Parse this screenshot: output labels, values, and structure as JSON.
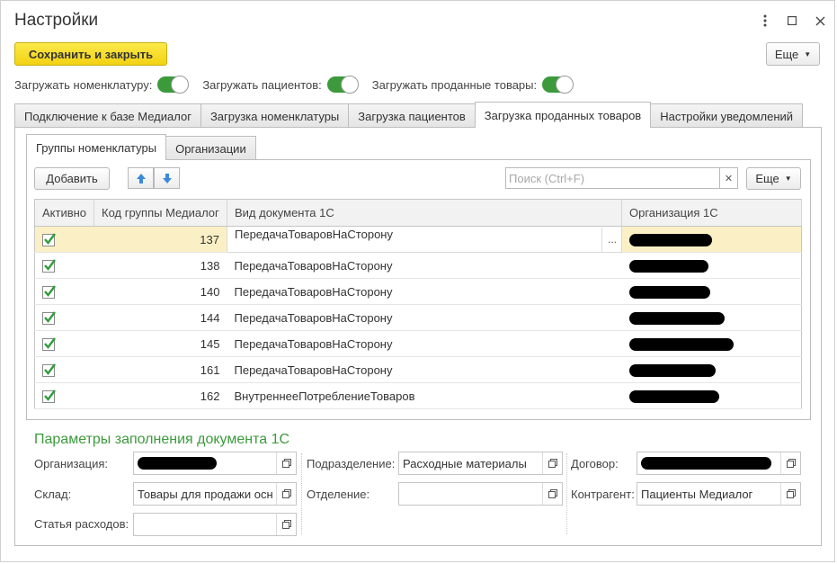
{
  "window": {
    "title": "Настройки",
    "more_label": "Еще"
  },
  "toolbar": {
    "save_close_label": "Сохранить и закрыть"
  },
  "toggles": [
    {
      "label": "Загружать номенклатуру:",
      "on": true
    },
    {
      "label": "Загружать пациентов:",
      "on": true
    },
    {
      "label": "Загружать проданные товары:",
      "on": true
    }
  ],
  "main_tabs": [
    {
      "label": "Подключение к базе Медиалог",
      "active": false
    },
    {
      "label": "Загрузка номенклатуры",
      "active": false
    },
    {
      "label": "Загрузка пациентов",
      "active": false
    },
    {
      "label": "Загрузка проданных товаров",
      "active": true
    },
    {
      "label": "Настройки уведомлений",
      "active": false
    }
  ],
  "sub_tabs": [
    {
      "label": "Группы номенклатуры",
      "active": true
    },
    {
      "label": "Организации",
      "active": false
    }
  ],
  "list_toolbar": {
    "add_label": "Добавить",
    "search_placeholder": "Поиск (Ctrl+F)",
    "more_label": "Еще"
  },
  "table": {
    "columns": [
      "Активно",
      "Код группы Медиалог",
      "Вид документа 1С",
      "Организация 1С"
    ],
    "rows": [
      {
        "active": true,
        "code": "137",
        "doc": "ПередачаТоваровНаСторону",
        "org": "[redacted]",
        "selected": true
      },
      {
        "active": true,
        "code": "138",
        "doc": "ПередачаТоваровНаСторону",
        "org": "[redacted]"
      },
      {
        "active": true,
        "code": "140",
        "doc": "ПередачаТоваровНаСторону",
        "org": "[redacted]"
      },
      {
        "active": true,
        "code": "144",
        "doc": "ПередачаТоваровНаСторону",
        "org": "[redacted]"
      },
      {
        "active": true,
        "code": "145",
        "doc": "ПередачаТоваровНаСторону",
        "org": "[redacted]"
      },
      {
        "active": true,
        "code": "161",
        "doc": "ПередачаТоваровНаСторону",
        "org": "[redacted]"
      },
      {
        "active": true,
        "code": "162",
        "doc": "ВнутреннееПотреблениеТоваров",
        "org": "[redacted]"
      }
    ]
  },
  "params": {
    "title": "Параметры заполнения документа 1С",
    "org_label": "Организация:",
    "org_value": "[redacted]",
    "warehouse_label": "Склад:",
    "warehouse_value": "Товары для продажи осно",
    "expense_label": "Статья расходов:",
    "expense_value": "",
    "subdivision_label": "Подразделение:",
    "subdivision_value": "Расходные материалы",
    "department_label": "Отделение:",
    "department_value": "",
    "contract_label": "Договор:",
    "contract_value": "[redacted]",
    "counterparty_label": "Контрагент:",
    "counterparty_value": "Пациенты Медиалог"
  },
  "colors": {
    "accent_green": "#3c9a3c",
    "save_button_yellow": "#f5d81c",
    "selected_row": "#fbf0c5"
  }
}
